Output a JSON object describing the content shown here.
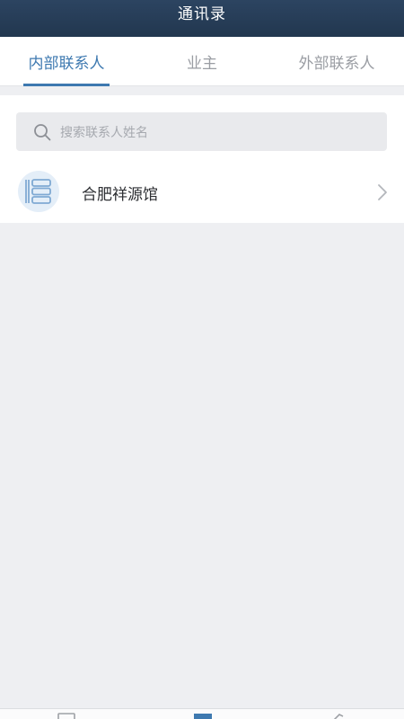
{
  "header": {
    "title": "通讯录"
  },
  "tabs": [
    {
      "label": "内部联系人",
      "active": true
    },
    {
      "label": "业主",
      "active": false
    },
    {
      "label": "外部联系人",
      "active": false
    }
  ],
  "search": {
    "placeholder": "搜索联系人姓名",
    "icon": "search-icon"
  },
  "contacts": [
    {
      "name": "合肥祥源馆",
      "icon": "server-stack-icon"
    }
  ],
  "bottom_nav": [
    {
      "icon": "document-icon",
      "active": false
    },
    {
      "icon": "contacts-icon",
      "active": true
    },
    {
      "icon": "settings-icon",
      "active": false
    }
  ],
  "colors": {
    "header_bg": "#22374f",
    "accent": "#3e79b0",
    "page_bg": "#eeeff2",
    "tab_inactive": "#9a9da3"
  }
}
